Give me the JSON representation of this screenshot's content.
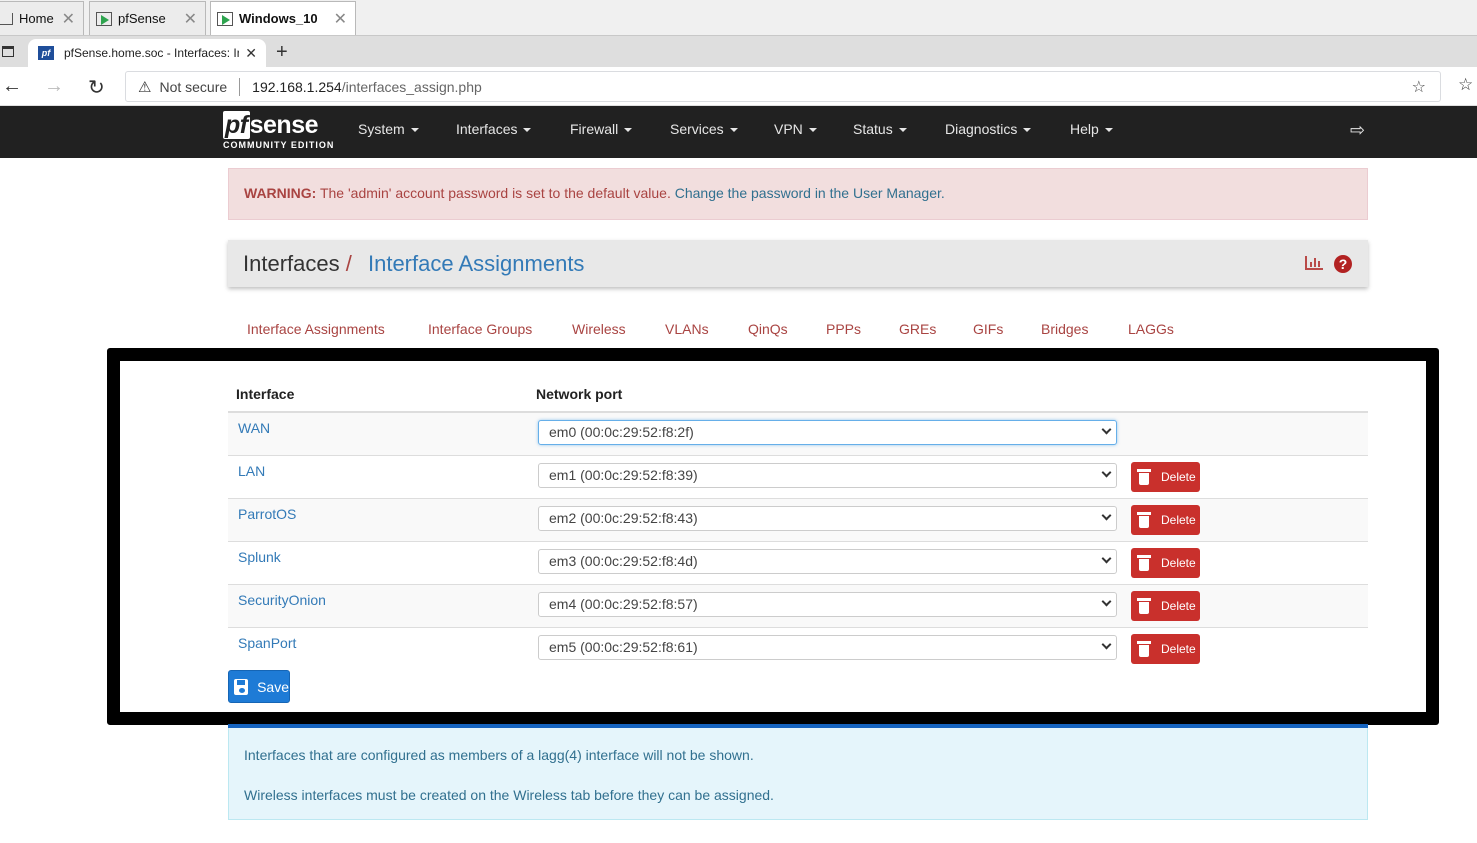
{
  "vm_tabs": [
    {
      "label": "Home"
    },
    {
      "label": "pfSense"
    },
    {
      "label": "Windows_10"
    }
  ],
  "browser": {
    "tab_title": "pfSense.home.soc - Interfaces: Interface Assignments",
    "security_label": "Not secure",
    "url_host": "192.168.1.254",
    "url_path": "/interfaces_assign.php"
  },
  "navbar": {
    "logo_text": "sense",
    "logo_prefix": "pf",
    "logo_sub": "COMMUNITY EDITION",
    "items": [
      "System",
      "Interfaces",
      "Firewall",
      "Services",
      "VPN",
      "Status",
      "Diagnostics",
      "Help"
    ]
  },
  "alert": {
    "label": "WARNING:",
    "text": " The 'admin' account password is set to the default value. ",
    "link": "Change the password in the User Manager."
  },
  "breadcrumb": {
    "parent": "Interfaces",
    "slash": "/",
    "current": "Interface Assignments"
  },
  "tabs": [
    "Interface Assignments",
    "Interface Groups",
    "Wireless",
    "VLANs",
    "QinQs",
    "PPPs",
    "GREs",
    "GIFs",
    "Bridges",
    "LAGGs"
  ],
  "table": {
    "headers": {
      "interface": "Interface",
      "port": "Network port"
    },
    "delete_label": "Delete",
    "rows": [
      {
        "name": "WAN",
        "port": "em0 (00:0c:29:52:f8:2f)"
      },
      {
        "name": "LAN",
        "port": "em1 (00:0c:29:52:f8:39)"
      },
      {
        "name": "ParrotOS",
        "port": "em2 (00:0c:29:52:f8:43)"
      },
      {
        "name": "Splunk",
        "port": "em3 (00:0c:29:52:f8:4d)"
      },
      {
        "name": "SecurityOnion",
        "port": "em4 (00:0c:29:52:f8:57)"
      },
      {
        "name": "SpanPort",
        "port": "em5 (00:0c:29:52:f8:61)"
      }
    ]
  },
  "save_label": "Save",
  "info": {
    "line1": "Interfaces that are configured as members of a lagg(4) interface will not be shown.",
    "line2": "Wireless interfaces must be created on the Wireless tab before they can be assigned."
  },
  "colors": {
    "navbar": "#212121",
    "link": "#337ab7",
    "danger": "#c9302c",
    "primary": "#1e7bd6",
    "tab_link": "#a94442"
  }
}
